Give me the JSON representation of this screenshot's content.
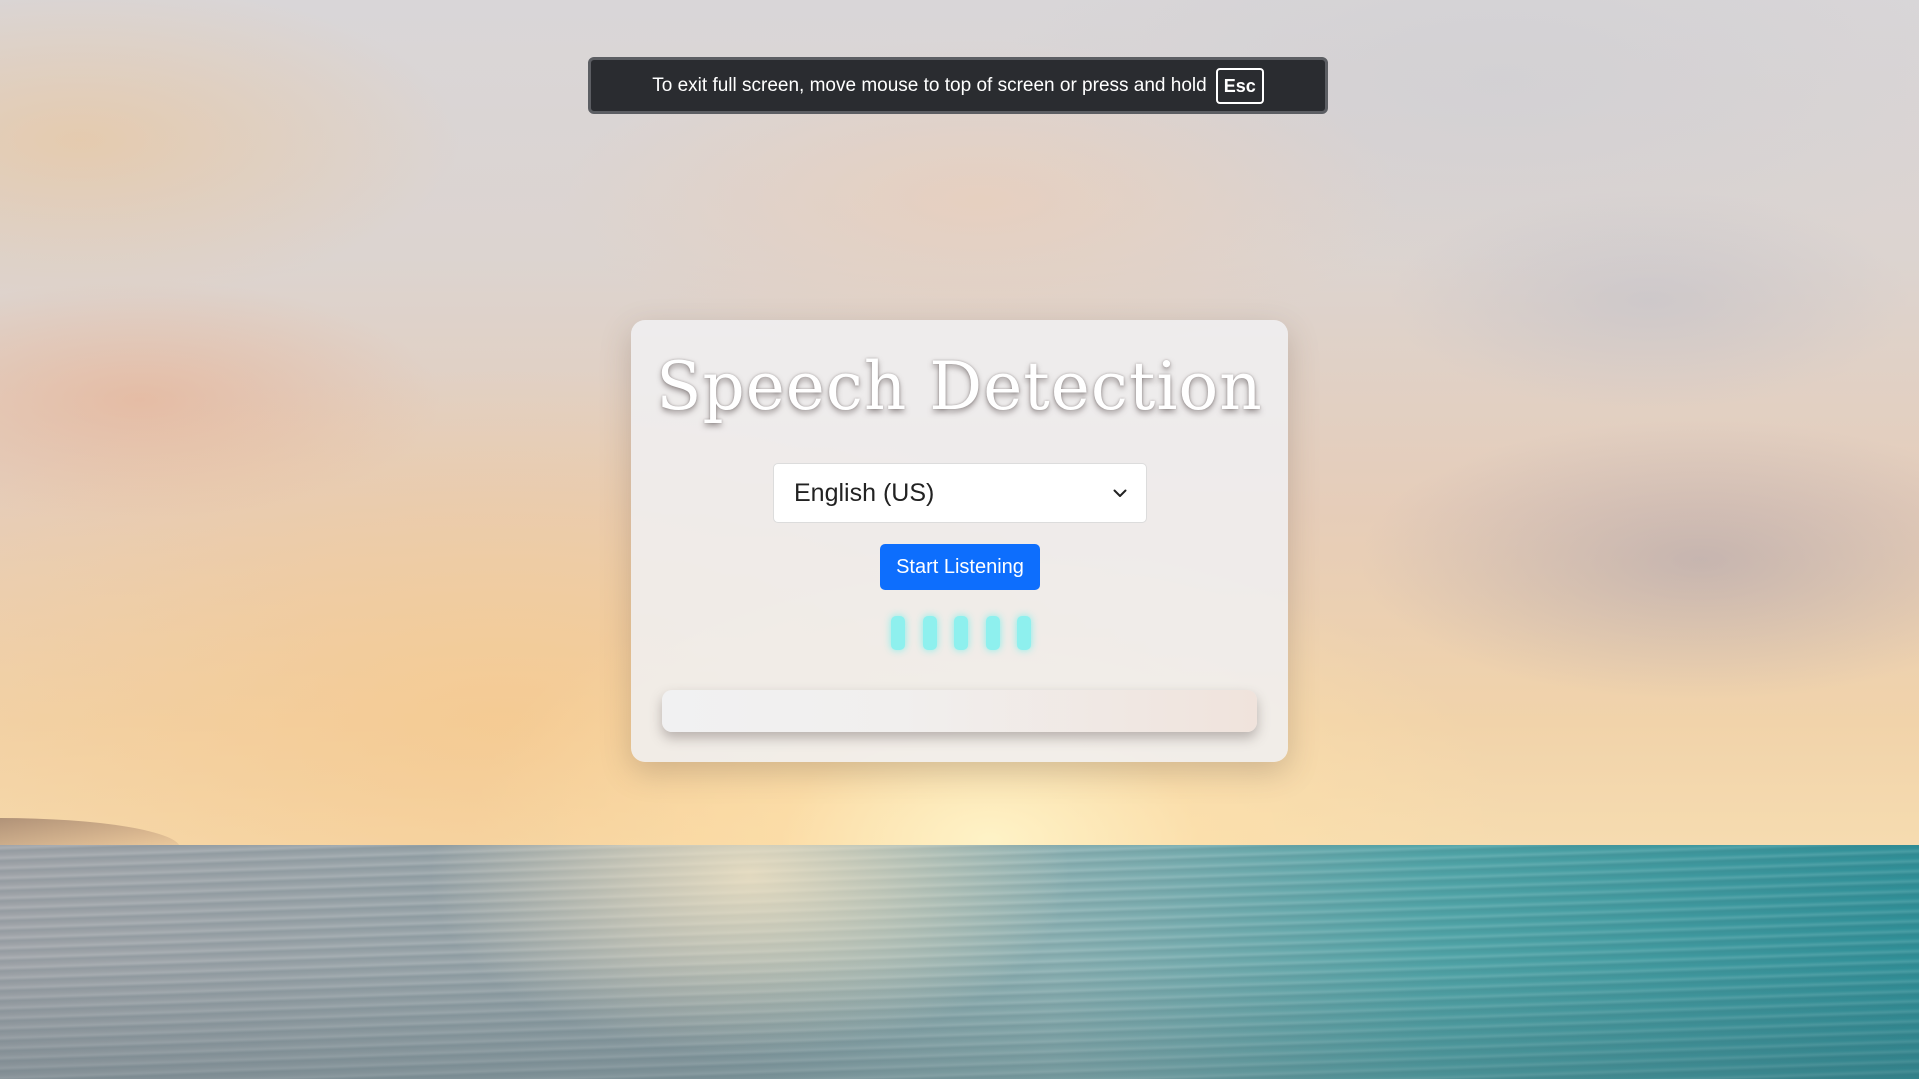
{
  "fullscreen_notice": {
    "text": "To exit full screen, move mouse to top of screen or press and hold",
    "key": "Esc"
  },
  "app": {
    "title": "Speech Detection",
    "language_select": {
      "selected": "English (US)"
    },
    "start_button_label": "Start Listening",
    "transcript_text": "",
    "colors": {
      "button": "#0d6efd",
      "visualizer_bars": "#8ef0ee"
    },
    "icons": {
      "select_arrow": "chevron-down-icon"
    }
  }
}
